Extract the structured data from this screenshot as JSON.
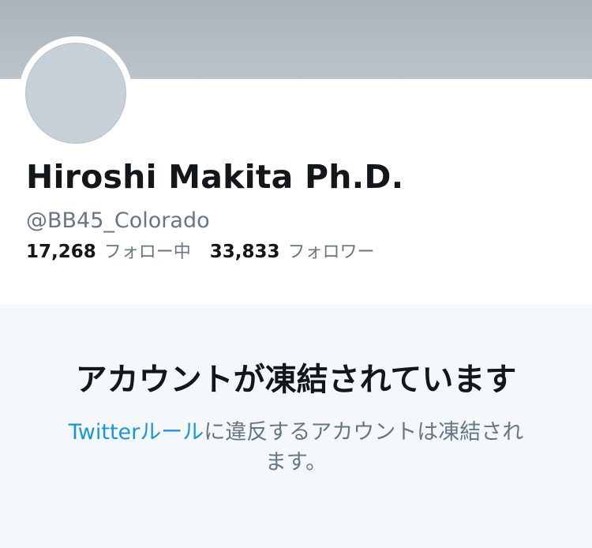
{
  "profile": {
    "display_name": "Hiroshi Makita Ph.D.",
    "handle": "@BB45_Colorado",
    "following_count": "17,268",
    "following_label": "フォロー中",
    "followers_count": "33,833",
    "followers_label": "フォロワー"
  },
  "suspension": {
    "title": "アカウントが凍結されています",
    "rules_link_text": "Twitterルール",
    "body_text": "に違反するアカウントは凍結されます。"
  },
  "colors": {
    "banner": "#b4bcc3",
    "link": "#1b95e0",
    "muted_text": "#657786",
    "primary_text": "#14171a",
    "page_background": "#f5f8fa"
  }
}
